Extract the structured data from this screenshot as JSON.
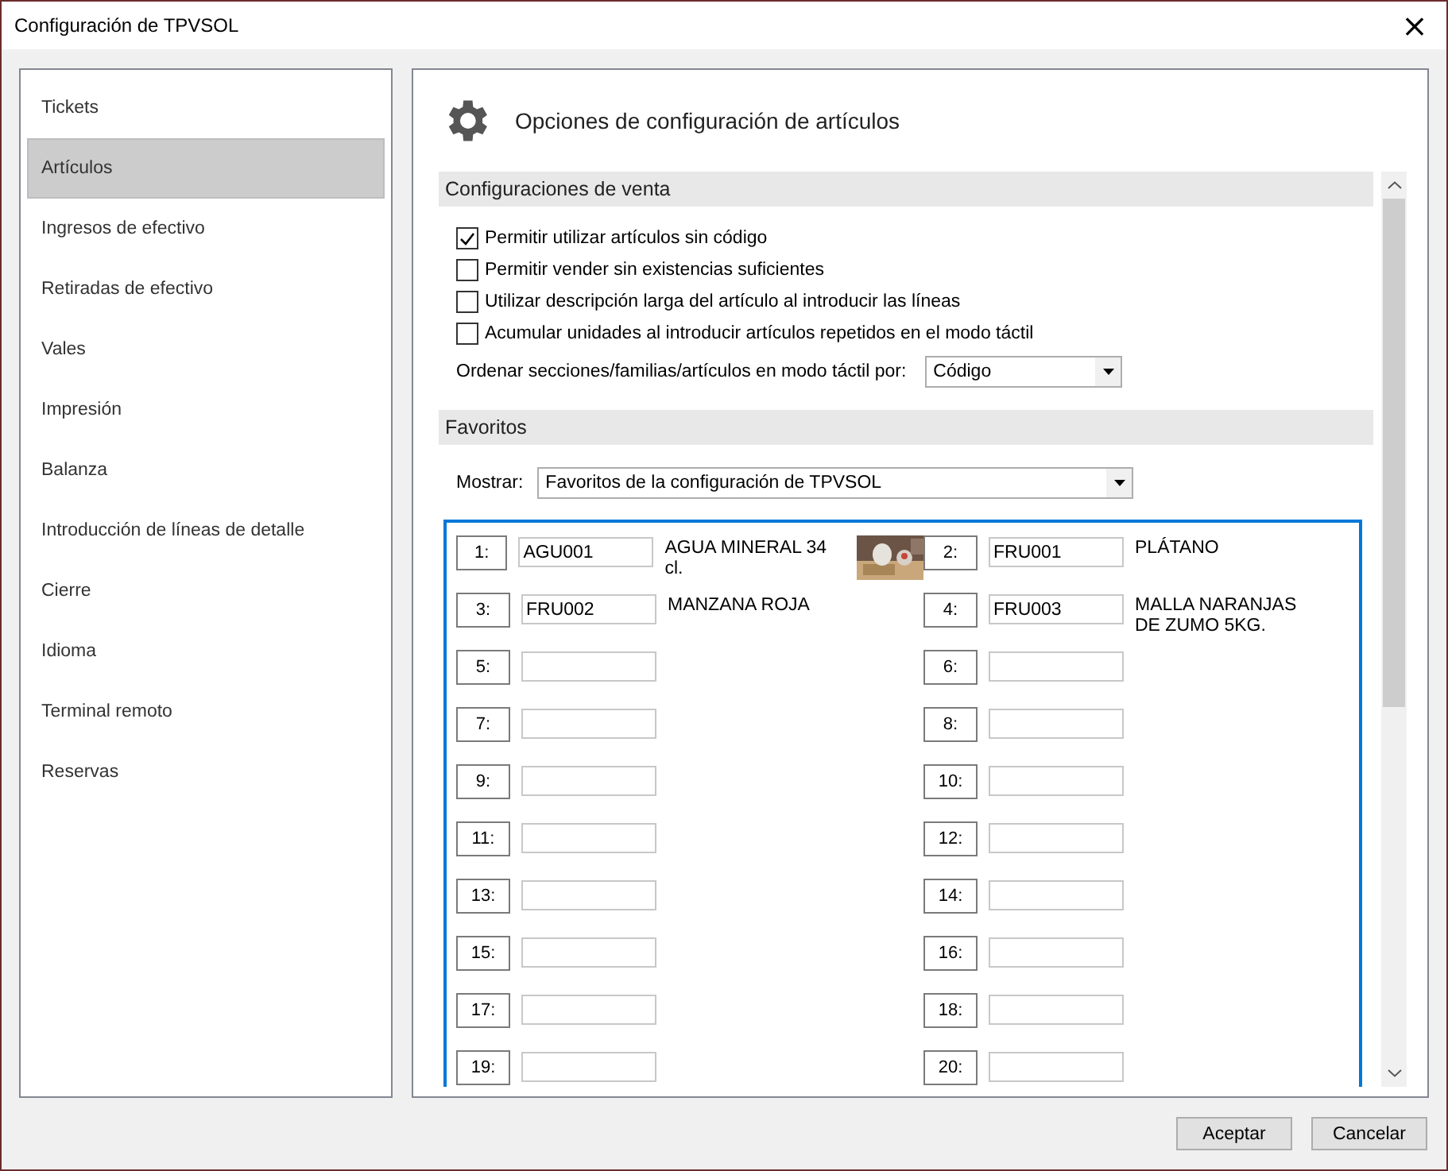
{
  "window": {
    "title": "Configuración de TPVSOL",
    "close": "×"
  },
  "sidebar": {
    "items": [
      {
        "label": "Tickets",
        "selected": false
      },
      {
        "label": "Artículos",
        "selected": true
      },
      {
        "label": "Ingresos de efectivo",
        "selected": false
      },
      {
        "label": "Retiradas de efectivo",
        "selected": false
      },
      {
        "label": "Vales",
        "selected": false
      },
      {
        "label": "Impresión",
        "selected": false
      },
      {
        "label": "Balanza",
        "selected": false
      },
      {
        "label": "Introducción de líneas de detalle",
        "selected": false
      },
      {
        "label": "Cierre",
        "selected": false
      },
      {
        "label": "Idioma",
        "selected": false
      },
      {
        "label": "Terminal remoto",
        "selected": false
      },
      {
        "label": "Reservas",
        "selected": false
      }
    ]
  },
  "header": {
    "title": "Opciones de configuración de artículos"
  },
  "sales": {
    "title": "Configuraciones de venta",
    "options": [
      {
        "label": "Permitir utilizar artículos sin código",
        "checked": true
      },
      {
        "label": "Permitir vender sin existencias suficientes",
        "checked": false
      },
      {
        "label": "Utilizar descripción larga del artículo al introducir las líneas",
        "checked": false
      },
      {
        "label": "Acumular unidades al introducir artículos repetidos en el modo táctil",
        "checked": false
      }
    ],
    "sort": {
      "label": "Ordenar secciones/familias/artículos en modo táctil por:",
      "value": "Código"
    }
  },
  "favorites": {
    "title": "Favoritos",
    "show": {
      "label": "Mostrar:",
      "value": "Favoritos de la configuración de TPVSOL"
    },
    "slots": [
      {
        "number": "1:",
        "code": "AGU001",
        "name": "AGUA MINERAL 34 cl.",
        "kind": "picture"
      },
      {
        "number": "2:",
        "code": "FRU001",
        "name": "PLÁTANO",
        "kind": "plain"
      },
      {
        "number": "3:",
        "code": "FRU002",
        "name": "MANZANA ROJA",
        "kind": "plain"
      },
      {
        "number": "4:",
        "code": "FRU003",
        "name": "MALLA NARANJAS DE ZUMO 5KG.",
        "kind": "plain"
      },
      {
        "number": "5:",
        "kind": "plain"
      },
      {
        "number": "6:",
        "kind": "plain"
      },
      {
        "number": "7:",
        "kind": "plain"
      },
      {
        "number": "8:",
        "kind": "plain"
      },
      {
        "number": "9:",
        "kind": "plain"
      },
      {
        "number": "10:",
        "kind": "plain"
      },
      {
        "number": "11:",
        "kind": "plain"
      },
      {
        "number": "12:",
        "kind": "plain"
      },
      {
        "number": "13:",
        "kind": "plain"
      },
      {
        "number": "14:",
        "kind": "plain"
      },
      {
        "number": "15:",
        "kind": "plain"
      },
      {
        "number": "16:",
        "kind": "plain"
      },
      {
        "number": "17:",
        "kind": "plain"
      },
      {
        "number": "18:",
        "kind": "plain"
      },
      {
        "number": "19:",
        "kind": "plain"
      },
      {
        "number": "20:",
        "kind": "plain"
      }
    ]
  },
  "buttons": [
    "Aceptar",
    "Cancelar"
  ]
}
